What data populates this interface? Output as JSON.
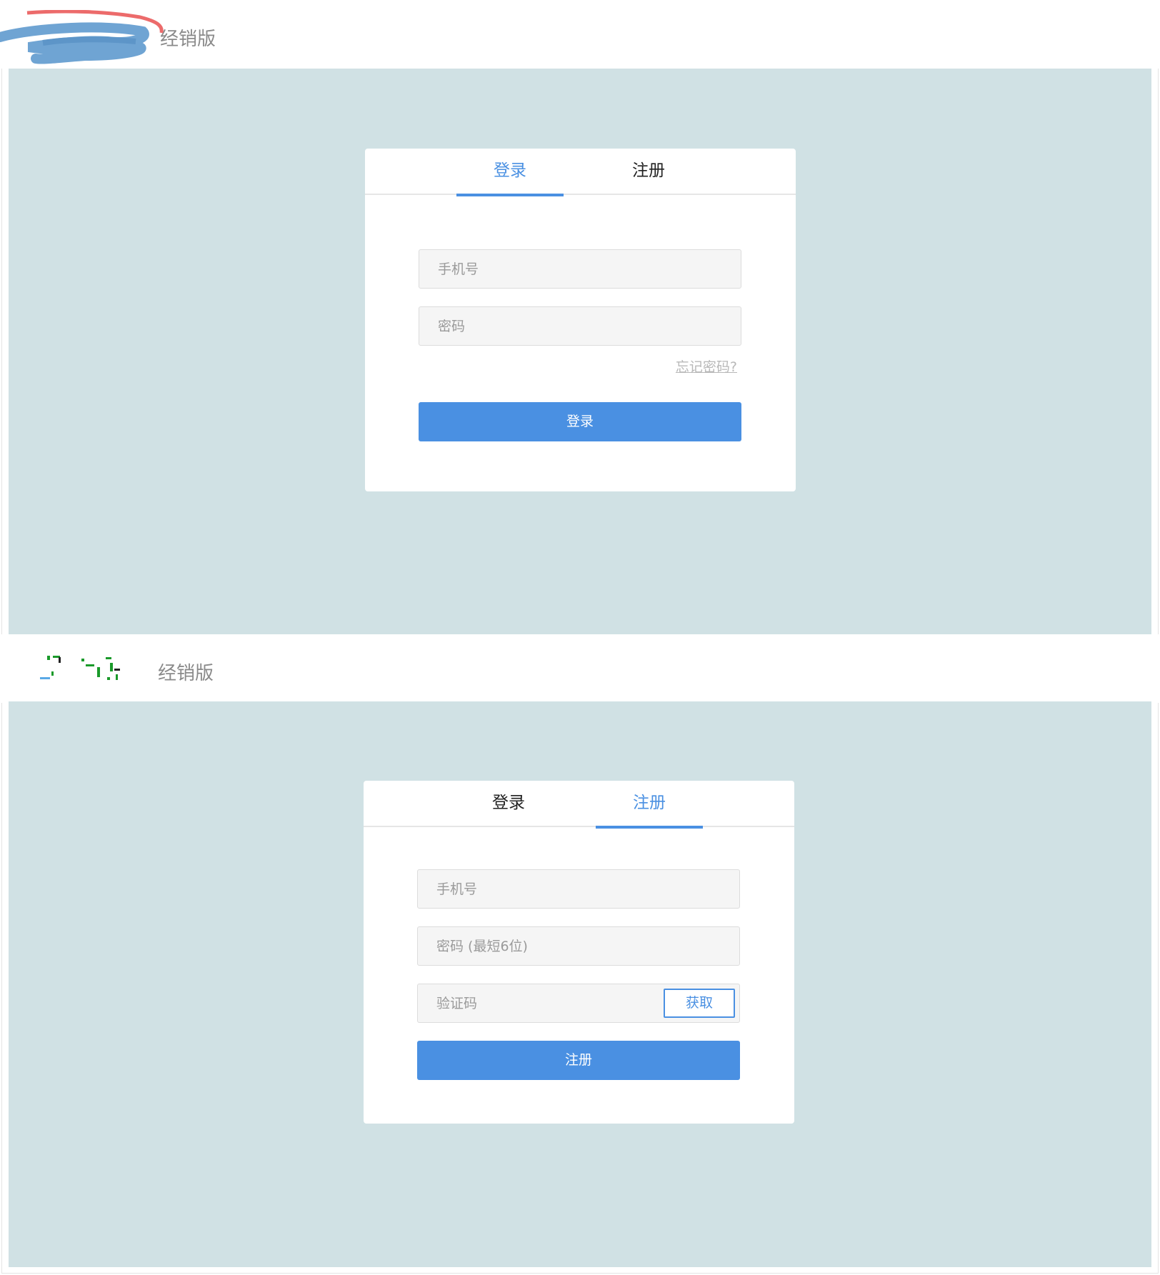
{
  "top": {
    "edition_label": "经销版",
    "tabs": [
      {
        "label": "登录",
        "active": true
      },
      {
        "label": "注册",
        "active": false
      }
    ],
    "phone_placeholder": "手机号",
    "password_placeholder": "密码",
    "forgot_label": "忘记密码?",
    "submit_label": "登录"
  },
  "bottom": {
    "edition_label": "经销版",
    "tabs": [
      {
        "label": "登录",
        "active": false
      },
      {
        "label": "注册",
        "active": true
      }
    ],
    "phone_placeholder": "手机号",
    "password_placeholder": "密码 (最短6位)",
    "code_placeholder": "验证码",
    "get_code_label": "获取",
    "submit_label": "注册"
  },
  "colors": {
    "accent": "#4a90e2",
    "stage_bg": "#d0e1e4"
  },
  "icons": {
    "top_logo": "brand-logo-redacted",
    "bottom_logo": "brand-logo-redacted"
  }
}
